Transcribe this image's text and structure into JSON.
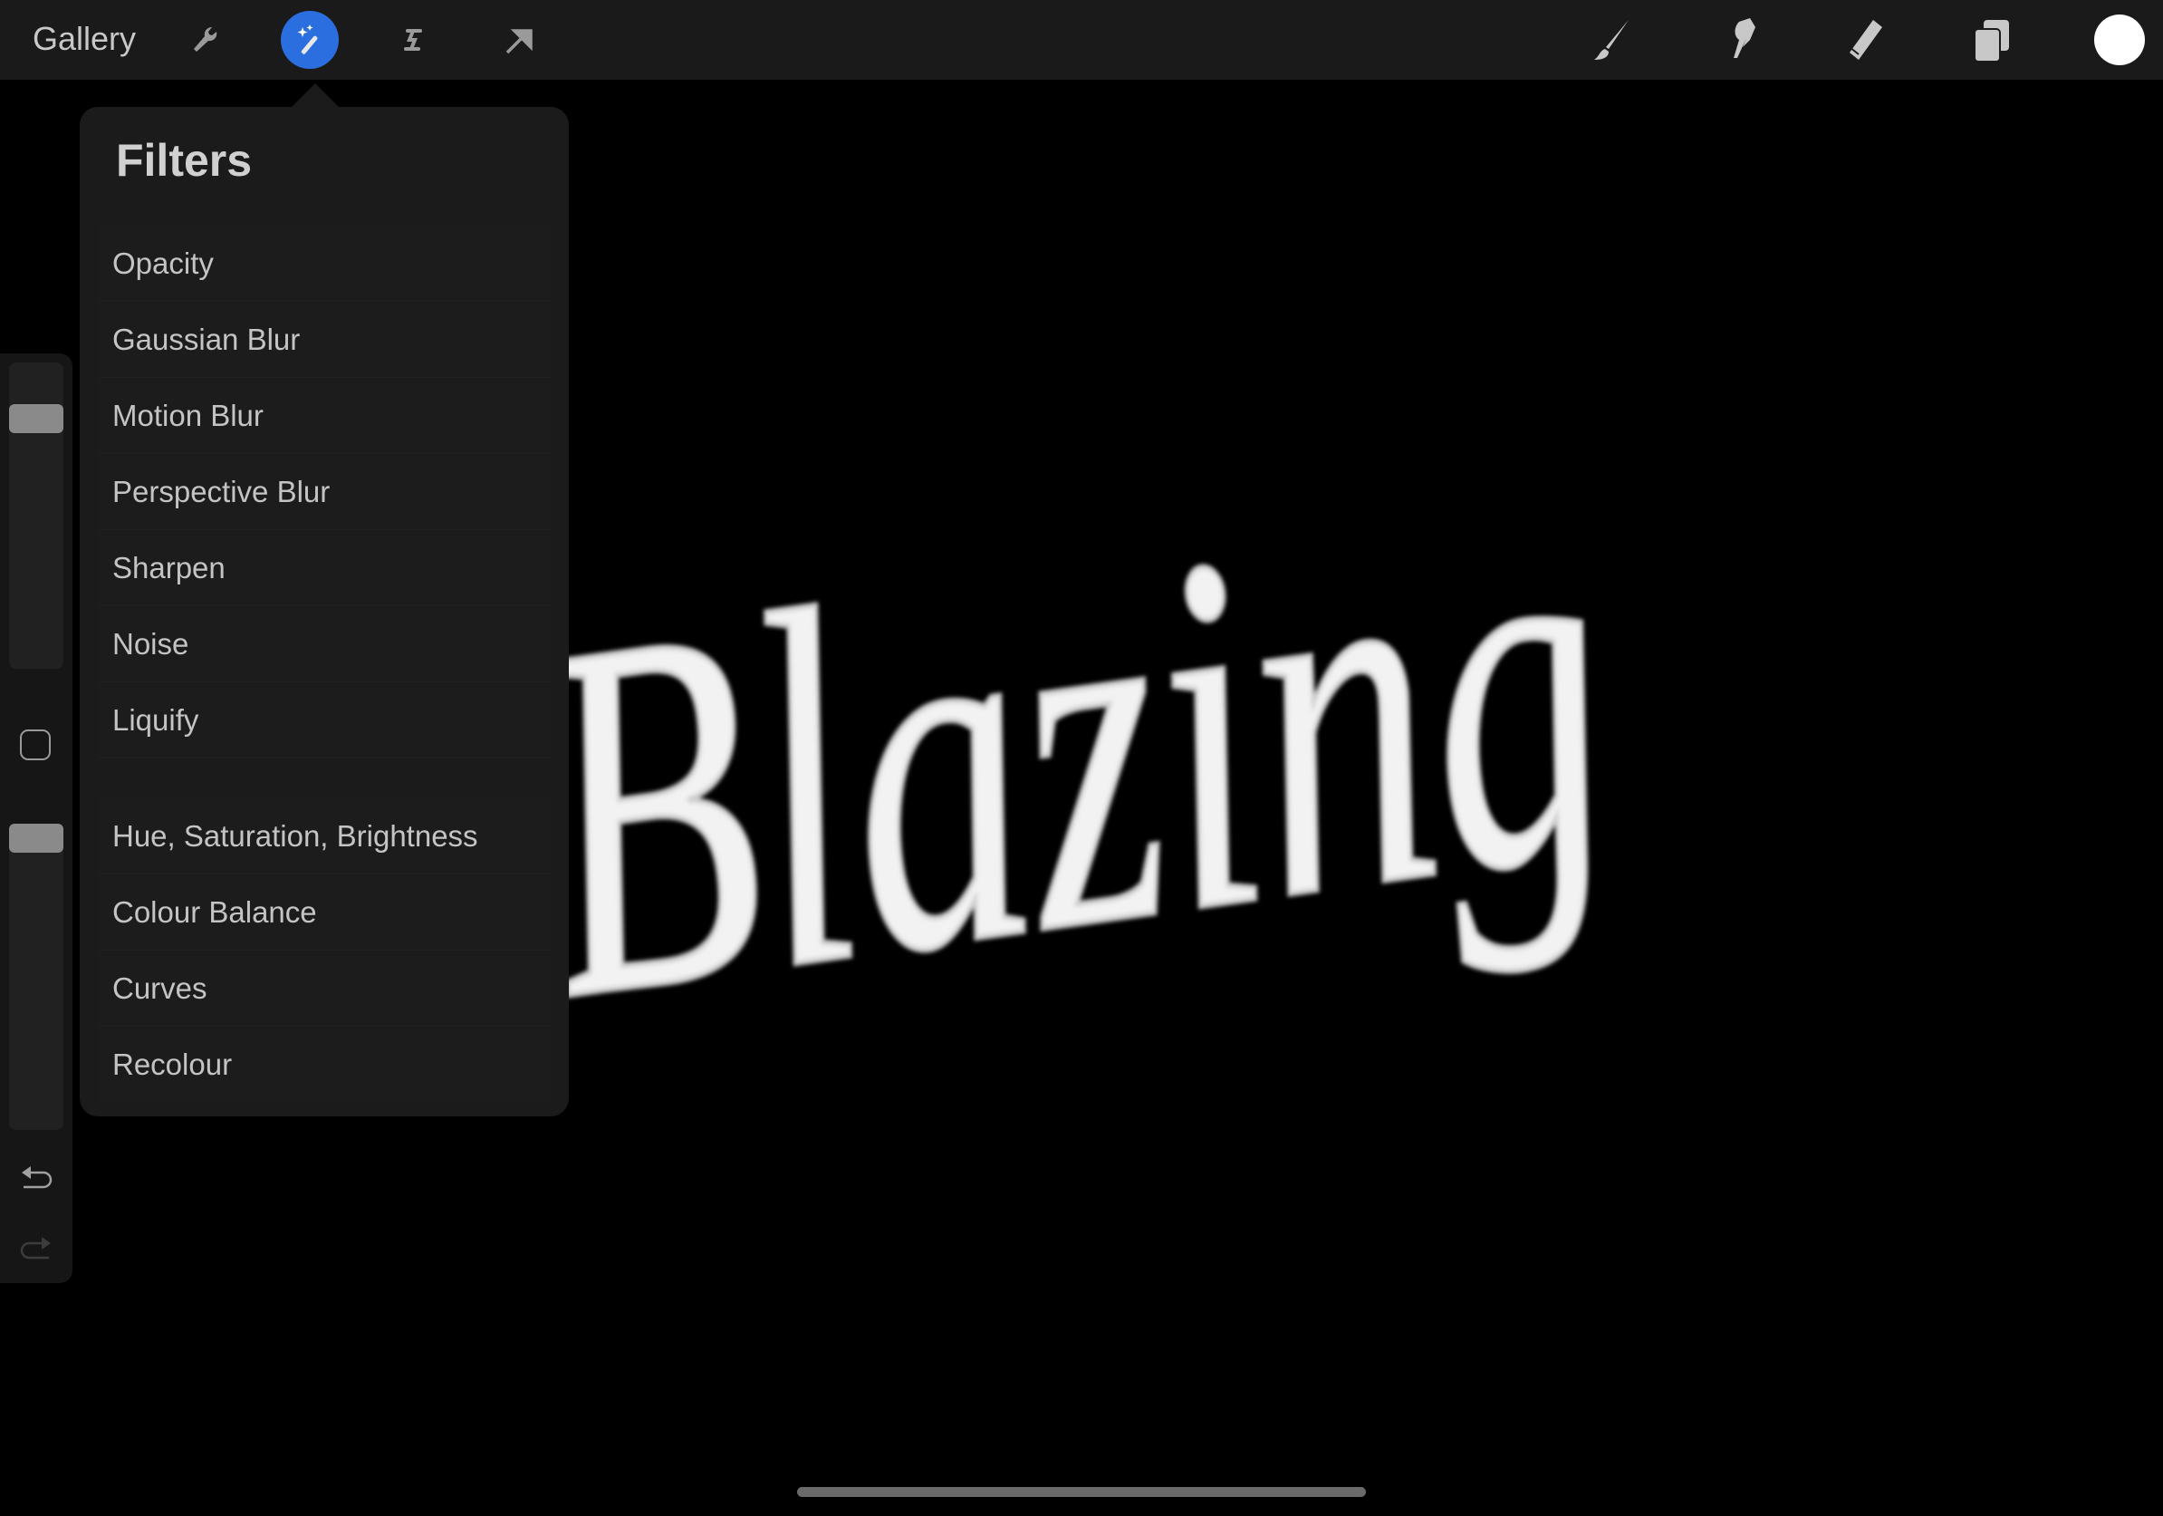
{
  "topbar": {
    "gallery_label": "Gallery",
    "left_tools": [
      "wrench-icon",
      "magic-wand-icon",
      "selection-icon",
      "transform-arrow-icon"
    ],
    "active_tool": "magic-wand-icon",
    "active_color_accent": "#2b6ee0",
    "right_tools": [
      "brush-icon",
      "smudge-icon",
      "eraser-icon",
      "layers-icon"
    ],
    "current_color": "#ffffff"
  },
  "filters": {
    "title": "Filters",
    "group1": [
      "Opacity",
      "Gaussian Blur",
      "Motion Blur",
      "Perspective Blur",
      "Sharpen",
      "Noise",
      "Liquify"
    ],
    "group2": [
      "Hue, Saturation, Brightness",
      "Colour Balance",
      "Curves",
      "Recolour"
    ]
  },
  "sidebar": {
    "brush_size_level": 0.85,
    "opacity_level": 1.0
  },
  "canvas": {
    "artwork_text": "Blazing"
  }
}
